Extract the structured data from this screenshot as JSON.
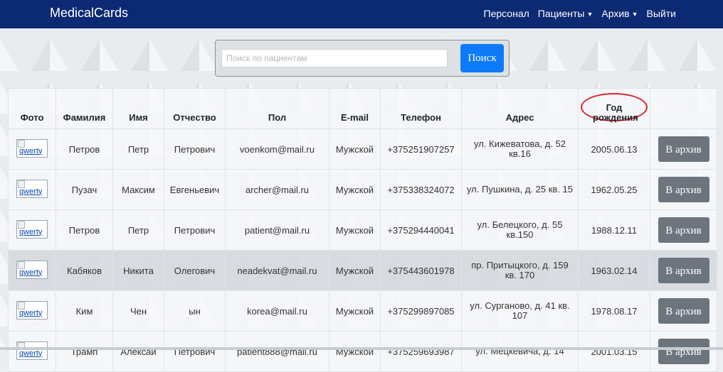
{
  "navbar": {
    "brand": "MedicalCards",
    "links": {
      "staff": "Персонал",
      "patients": "Пациенты",
      "archive": "Архив",
      "logout": "Выйти"
    }
  },
  "search": {
    "placeholder": "Поиск по пациентам",
    "button_label": "Поиск"
  },
  "table": {
    "headers": [
      "Фото",
      "Фамилия",
      "Имя",
      "Отчество",
      "Пол",
      "E-mail",
      "Телефон",
      "Адрес",
      "Год рождения"
    ],
    "photo_alt": "qwerty",
    "archive_label": "В архив",
    "rows": [
      {
        "surname": "Петров",
        "name": "Петр",
        "patronymic": "Петрович",
        "gender_col": "voenkom@mail.ru",
        "email_col": "Мужской",
        "phone": "+375251907257",
        "address": "ул. Кижеватова, д. 52 кв.16",
        "birth": "2005.06.13"
      },
      {
        "surname": "Пузач",
        "name": "Максим",
        "patronymic": "Евгеньевич",
        "gender_col": "archer@mail.ru",
        "email_col": "Мужской",
        "phone": "+375338324072",
        "address": "ул. Пушкина, д. 25 кв. 15",
        "birth": "1962.05.25"
      },
      {
        "surname": "Петров",
        "name": "Петр",
        "patronymic": "Петрович",
        "gender_col": "patient@mail.ru",
        "email_col": "Мужской",
        "phone": "+375294440041",
        "address": "ул. Белецкого, д. 55 кв.150",
        "birth": "1988.12.11"
      },
      {
        "surname": "Кабяков",
        "name": "Никита",
        "patronymic": "Олегович",
        "gender_col": "neadekvat@mail.ru",
        "email_col": "Мужской",
        "phone": "+375443601978",
        "address": "пр. Притыцкого, д. 159 кв. 170",
        "birth": "1963.02.14"
      },
      {
        "surname": "Ким",
        "name": "Чен",
        "patronymic": "ын",
        "gender_col": "korea@mail.ru",
        "email_col": "Мужской",
        "phone": "+375299897085",
        "address": "ул. Сурганово, д. 41 кв. 107",
        "birth": "1978.08.17"
      },
      {
        "surname": "Трамп",
        "name": "Алексай",
        "patronymic": "Петрович",
        "gender_col": "patient888@mail.ru",
        "email_col": "Мужской",
        "phone": "+375259693987",
        "address": "ул. Мецкевича, д. 14",
        "birth": "2001.03.15"
      }
    ]
  },
  "colors": {
    "navbar": "#0b2a73",
    "search_button": "#0d7bf7",
    "archive_button": "#6c757d",
    "annotation_circle": "#d9242a"
  }
}
